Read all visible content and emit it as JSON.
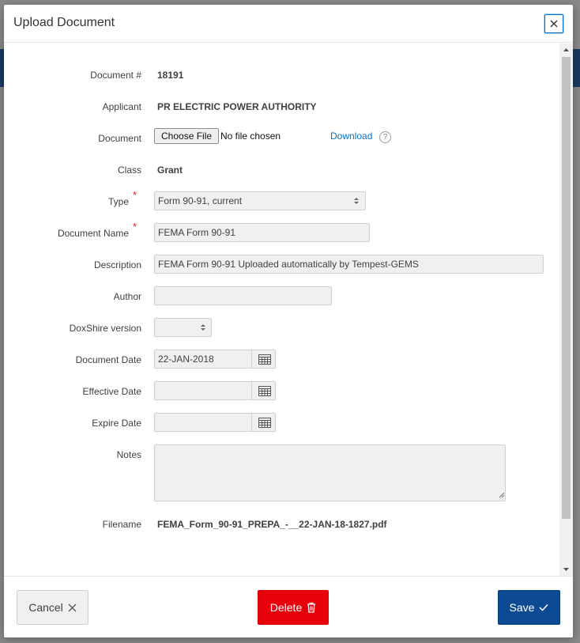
{
  "dialog": {
    "title": "Upload Document"
  },
  "fields": {
    "document_no": {
      "label": "Document #",
      "value": "18191"
    },
    "applicant": {
      "label": "Applicant",
      "value": "PR ELECTRIC POWER AUTHORITY"
    },
    "document": {
      "label": "Document",
      "choose_label": "Choose File",
      "status": "No file chosen",
      "download": "Download",
      "help": "?"
    },
    "class": {
      "label": "Class",
      "value": "Grant"
    },
    "type": {
      "label": "Type",
      "value": "Form 90-91, current",
      "required": "*"
    },
    "document_name": {
      "label": "Document Name",
      "value": "FEMA Form 90-91",
      "required": "*"
    },
    "description": {
      "label": "Description",
      "value": "FEMA Form 90-91 Uploaded automatically by Tempest-GEMS"
    },
    "author": {
      "label": "Author",
      "value": ""
    },
    "doxshire_version": {
      "label": "DoxShire version",
      "value": ""
    },
    "document_date": {
      "label": "Document Date",
      "value": "22-JAN-2018"
    },
    "effective_date": {
      "label": "Effective Date",
      "value": ""
    },
    "expire_date": {
      "label": "Expire Date",
      "value": ""
    },
    "notes": {
      "label": "Notes",
      "value": ""
    },
    "filename": {
      "label": "Filename",
      "value": "FEMA_Form_90-91_PREPA_-__22-JAN-18-1827.pdf"
    }
  },
  "buttons": {
    "cancel": "Cancel",
    "delete": "Delete",
    "save": "Save"
  },
  "colors": {
    "accent": "#0572ce",
    "delete": "#e8000b",
    "save": "#0d4a94",
    "required": "#e02020"
  }
}
